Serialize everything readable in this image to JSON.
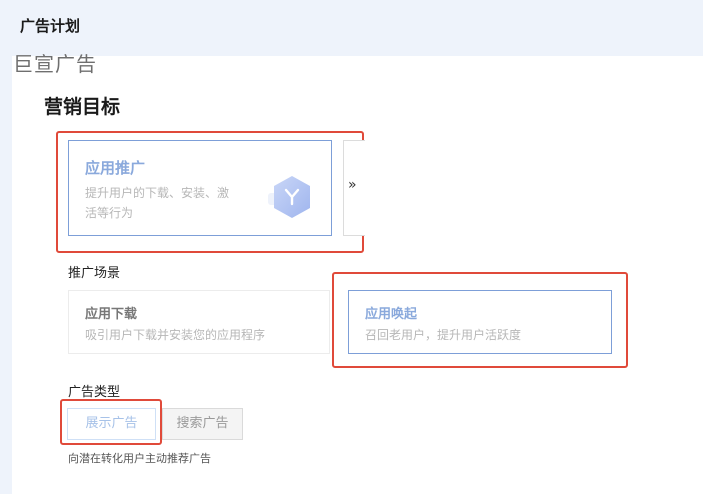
{
  "header": {
    "title": "广告计划"
  },
  "overlay": {
    "brand_text": "巨宣广告"
  },
  "marketing_goal": {
    "title": "营销目标",
    "app_promotion_card": {
      "title": "应用推广",
      "desc_line1": "提升用户的下载、安装、激",
      "desc_line2": "活等行为",
      "icon": "hexagon-y-icon",
      "accent": "#7d9fd8"
    },
    "next_arrow": "»"
  },
  "scene": {
    "label": "推广场景",
    "download_card": {
      "title": "应用下载",
      "desc": "吸引用户下载并安装您的应用程序"
    },
    "wakeup_card": {
      "title": "应用唤起",
      "desc": "召回老用户，提升用户活跃度"
    }
  },
  "ad_type": {
    "label": "广告类型",
    "display_button": "展示广告",
    "search_button": "搜索广告",
    "hint": "向潜在转化用户主动推荐广告"
  },
  "colors": {
    "highlight_border": "#e04a3a",
    "selected_border": "#7d9fd8",
    "header_bg": "#eef3fb"
  }
}
